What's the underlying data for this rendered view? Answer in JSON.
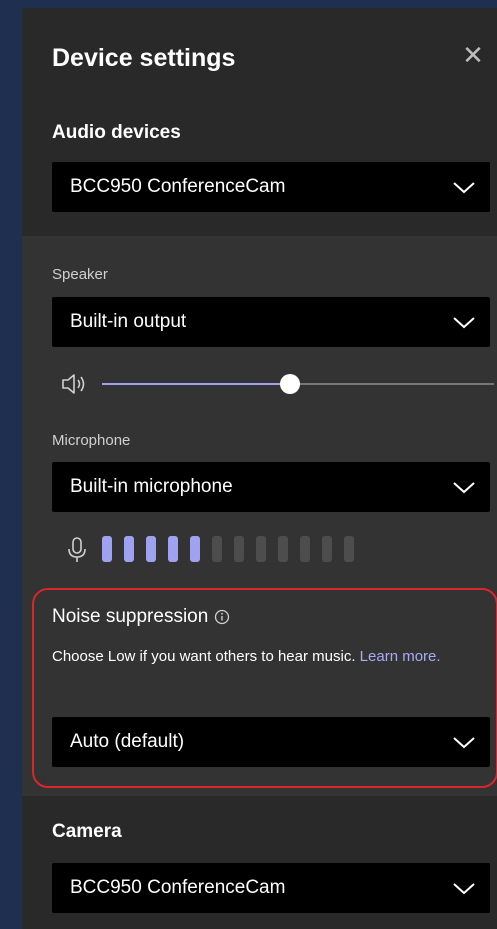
{
  "panel": {
    "title": "Device settings",
    "close_glyph": "✕"
  },
  "audio": {
    "title": "Audio devices",
    "selected": "BCC950 ConferenceCam"
  },
  "speaker": {
    "label": "Speaker",
    "selected": "Built-in output",
    "volume_fraction": 0.48
  },
  "microphone": {
    "label": "Microphone",
    "selected": "Built-in microphone",
    "level_active": 5,
    "level_total": 12
  },
  "noise": {
    "title": "Noise suppression",
    "description": "Choose Low if you want others to hear music.",
    "link": "Learn more.",
    "selected": "Auto (default)"
  },
  "camera": {
    "title": "Camera",
    "selected": "BCC950 ConferenceCam"
  },
  "colors": {
    "accent": "#9ea2f0",
    "highlight": "#d9262a",
    "background": "#1e2f4f"
  },
  "icons": [
    "close-icon",
    "chevron-down-icon",
    "speaker-icon",
    "microphone-icon",
    "info-icon"
  ]
}
